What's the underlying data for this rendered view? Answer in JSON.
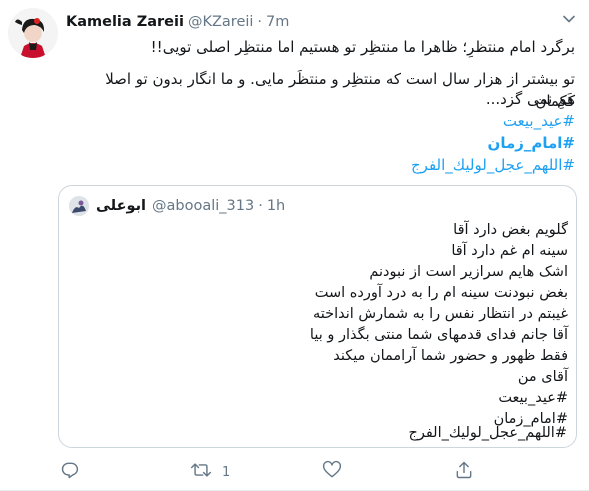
{
  "tweet": {
    "name": "Kamelia Zareii",
    "handle": "@KZareii",
    "separator": "·",
    "time": "7m",
    "lines": [
      "برگرد امام منتظرِ؛ ظاهرا ما منتظِر تو هستیم اما منتظِر اصلی تویی!!",
      "تو بیشتر از هزار سال است که منتظِر و منتظَر مایی. و ما انگار بدون تو اصلا کَکِمان",
      "هم نمی گزد..."
    ],
    "hashtags": [
      "#عید_بیعت",
      "#امام_زمان",
      "#اللهم_عجل_لولیك_الفرج"
    ]
  },
  "quote": {
    "name": "ابوعلی",
    "handle": "@abooali_313",
    "separator": "·",
    "time": "1h",
    "lines": [
      "گلویم بغض دارد آقا",
      "سینه ام غم دارد آقا",
      "اشک هایم سرازیر است از نبودنم",
      "بغض نبودنت سینه ام را به درد آورده است",
      "غیبتم در انتظار نفس را  به شمارش انداخته",
      "آقا جانم فدای قدمهای شما منتی بگذار و بیا",
      "فقط  ظهور و حضور شما آراممان میکند",
      "آقای من",
      "#عید_بیعت",
      "#امام_زمان",
      "#اللهم_عجل_لولیك_الفرج"
    ]
  },
  "actions": {
    "retweet_count": "1"
  },
  "colors": {
    "link": "#1da1f2",
    "secondary_text": "#657786",
    "border": "#ccd6dd"
  }
}
